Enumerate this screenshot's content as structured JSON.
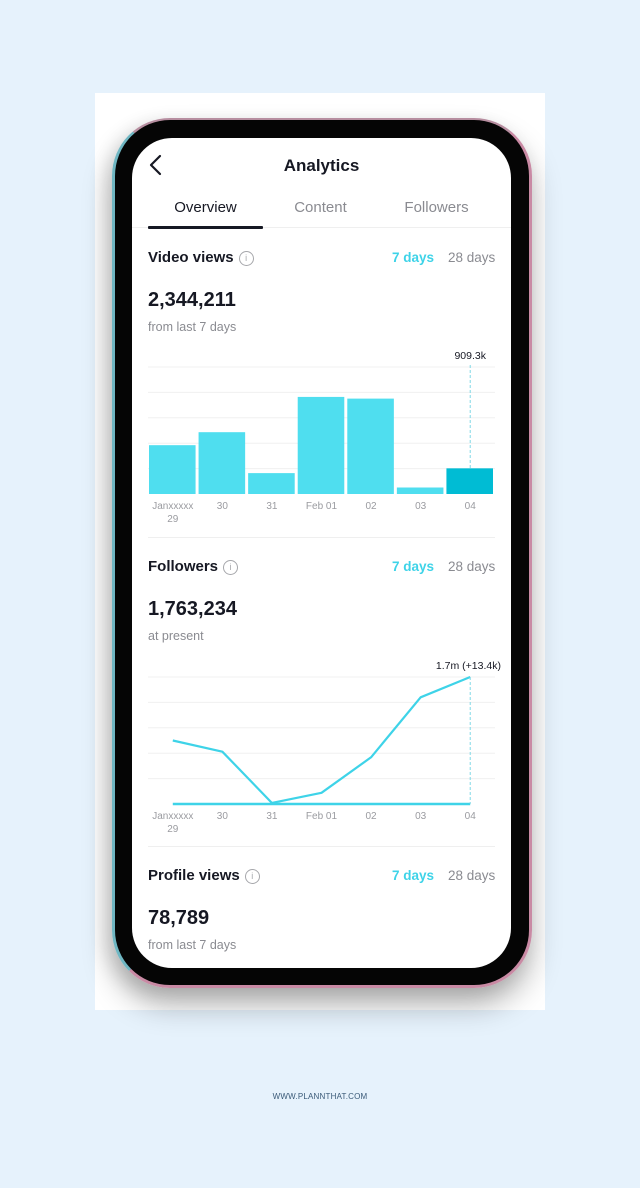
{
  "header": {
    "title": "Analytics",
    "back_icon": "chevron-left-icon"
  },
  "tabs": [
    {
      "label": "Overview",
      "active": true
    },
    {
      "label": "Content",
      "active": false
    },
    {
      "label": "Followers",
      "active": false
    }
  ],
  "sections": {
    "video_views": {
      "title": "Video views",
      "info_icon": "i",
      "range_7": "7 days",
      "range_28": "28 days",
      "value": "2,344,211",
      "subtitle": "from last 7 days"
    },
    "followers": {
      "title": "Followers",
      "info_icon": "i",
      "range_7": "7 days",
      "range_28": "28 days",
      "value": "1,763,234",
      "subtitle": "at present"
    },
    "profile_views": {
      "title": "Profile views",
      "info_icon": "i",
      "range_7": "7 days",
      "range_28": "28 days",
      "value": "78,789",
      "subtitle": "from last 7 days"
    }
  },
  "colors": {
    "accent": "#3ed3e8",
    "bar": "#4fdeef",
    "bar_highlight": "#00bcd4",
    "text": "#161823",
    "muted": "#8a8b91"
  },
  "chart_data": [
    {
      "type": "bar",
      "title": "Video views",
      "categories": [
        "Janxxxxx 29",
        "30",
        "31",
        "Feb 01",
        "02",
        "03",
        "04"
      ],
      "category_lines": [
        [
          "Janxxxxx",
          "29"
        ],
        [
          "30"
        ],
        [
          "31"
        ],
        [
          "Feb 01"
        ],
        [
          "02"
        ],
        [
          "03"
        ],
        [
          "04"
        ]
      ],
      "values": [
        1730,
        2190,
        740,
        3440,
        3380,
        230,
        909.3
      ],
      "unit": "k",
      "ylim": [
        0,
        4500
      ],
      "gridlines": 5,
      "highlight_index": 6,
      "highlight_label": "909.3k",
      "grid": true
    },
    {
      "type": "line",
      "title": "Followers",
      "categories": [
        "Janxxxxx 29",
        "30",
        "31",
        "Feb 01",
        "02",
        "03",
        "04"
      ],
      "category_lines": [
        [
          "Janxxxxx",
          "29"
        ],
        [
          "30"
        ],
        [
          "31"
        ],
        [
          "Feb 01"
        ],
        [
          "02"
        ],
        [
          "03"
        ],
        [
          "04"
        ]
      ],
      "values": [
        2.5,
        2.06,
        0.04,
        0.44,
        1.84,
        4.2,
        5.0
      ],
      "ylim": [
        0,
        5
      ],
      "gridlines": 5,
      "highlight_index": 6,
      "highlight_label": "1.7m (+13.4k)",
      "grid": true
    }
  ],
  "footer": {
    "text": "WWW.PLANNTHAT.COM"
  }
}
